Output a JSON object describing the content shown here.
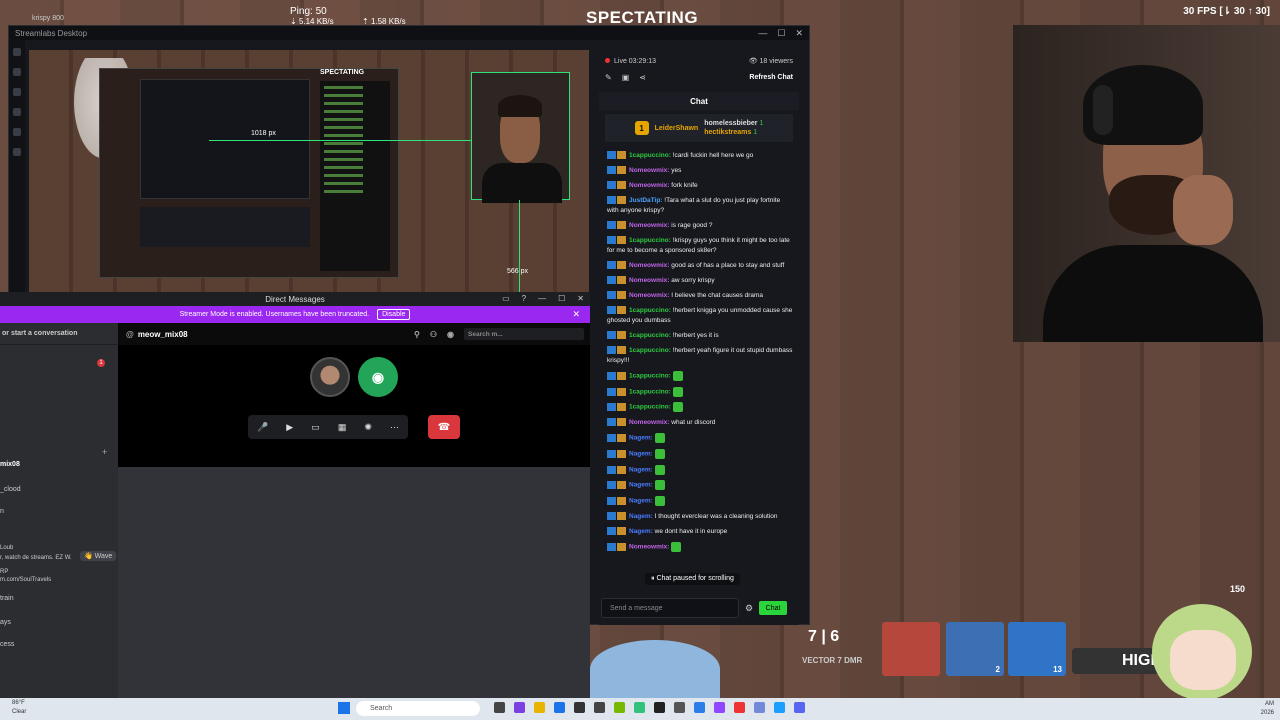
{
  "hud": {
    "ping": "Ping: 50",
    "down": "5.14 KB/s",
    "up": "1.58 KB/s",
    "spectating": "SPECTATING",
    "fps": "30 FPS [⇂ 30 ↑ 30]",
    "user_tag": "krispy",
    "user_tag_count": "800"
  },
  "streamlabs": {
    "title": "Streamlabs Desktop",
    "dim_h": "1018 px",
    "dim_w": "566 px",
    "mini_spec": "SPECTATING"
  },
  "chat": {
    "live": "Live 03:29:13",
    "viewers": "18 viewers",
    "refresh": "Refresh Chat",
    "header": "Chat",
    "hype_top": "LeiderShawn",
    "hype_a": "homelessbieber",
    "hype_b": "hectikstreams",
    "hype_a_count": "1",
    "hype_b_count": "1",
    "messages": [
      {
        "user": "1cappuccino:",
        "text": "!cardi fuckin hell here we go",
        "color": "#2ecc40"
      },
      {
        "user": "Nomeowmix:",
        "text": "yes",
        "color": "#c065e8"
      },
      {
        "user": "Nomeowmix:",
        "text": "fork knife",
        "color": "#c065e8"
      },
      {
        "user": "JustDaTip:",
        "text": "!Tara what a slut do you just play fortnite with anyone krispy?",
        "color": "#4aa3ff"
      },
      {
        "user": "Nomeowmix:",
        "text": "is rage good ?",
        "color": "#c065e8"
      },
      {
        "user": "1cappuccino:",
        "text": "!krispy guys you think it might be too late for me to become a sponsored sk8er?",
        "color": "#2ecc40"
      },
      {
        "user": "Nomeowmix:",
        "text": "good as of has a place to stay and stuff",
        "color": "#c065e8"
      },
      {
        "user": "Nomeowmix:",
        "text": "aw sorry krispy",
        "color": "#c065e8"
      },
      {
        "user": "Nomeowmix:",
        "text": "I believe the chat causes drama",
        "color": "#c065e8"
      },
      {
        "user": "1cappuccino:",
        "text": "!herbert knigga you unmodded cause she ghosted you dumbass",
        "color": "#2ecc40"
      },
      {
        "user": "1cappuccino:",
        "text": "!herbert yes it is",
        "color": "#2ecc40"
      },
      {
        "user": "1cappuccino:",
        "text": "!herbert yeah figure it out stupid dumbass krispy!!!",
        "color": "#2ecc40"
      },
      {
        "user": "1cappuccino:",
        "text": "",
        "color": "#2ecc40"
      },
      {
        "user": "1cappuccino:",
        "text": "",
        "color": "#2ecc40"
      },
      {
        "user": "1cappuccino:",
        "text": "",
        "color": "#2ecc40"
      },
      {
        "user": "Nomeowmix:",
        "text": "what ur discord",
        "color": "#c065e8"
      },
      {
        "user": "Nagem:",
        "text": "",
        "color": "#4a7dff"
      },
      {
        "user": "Nagem:",
        "text": "",
        "color": "#4a7dff"
      },
      {
        "user": "Nagem:",
        "text": "",
        "color": "#4a7dff"
      },
      {
        "user": "Nagem:",
        "text": "",
        "color": "#4a7dff"
      },
      {
        "user": "Nagem:",
        "text": "",
        "color": "#4a7dff"
      },
      {
        "user": "Nagem:",
        "text": "I thought everclear was a cleaning solution",
        "color": "#4a7dff"
      },
      {
        "user": "Nagem:",
        "text": "we dont have it in europe",
        "color": "#4a7dff"
      },
      {
        "user": "Nomeowmix:",
        "text": "",
        "color": "#c065e8"
      }
    ],
    "paused": "Chat paused for scrolling",
    "send_placeholder": "Send a message",
    "send_button": "Chat"
  },
  "discord": {
    "title": "Direct Messages",
    "streamer_notice": "Streamer Mode is enabled. Usernames have been truncated.",
    "disable": "Disable",
    "find": "or start a conversation",
    "channel": "meow_mix08",
    "search": "Search m...",
    "dm_items": [
      "mix08",
      "_clood",
      "n",
      "Loub",
      "r, watch de streams. EZ W.",
      "RP",
      "m.com/SoulTravels",
      "train",
      "ays",
      "cess",
      "Wave"
    ],
    "notif_count": "1"
  },
  "game_hud": {
    "ammo": "7 | 6",
    "weapon": "VECTOR 7 DMR",
    "slot2_count": "2",
    "slot3_count": "13",
    "highlight": "HIGH",
    "hp": "150"
  },
  "taskbar": {
    "weather_temp": "86°F",
    "weather_desc": "Clear",
    "search": "Search",
    "time": "AM",
    "date": "2026"
  }
}
